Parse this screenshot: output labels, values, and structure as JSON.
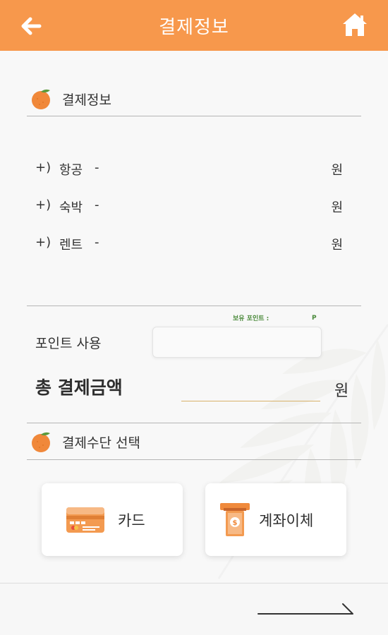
{
  "header": {
    "title": "결제정보",
    "back_icon": "arrow-left-icon",
    "home_icon": "home-icon",
    "background": "#f7984c"
  },
  "payment_info": {
    "heading": "결제정보",
    "icon": "tangerine-icon",
    "items": [
      {
        "prefix": "+)",
        "name": "항공",
        "dash": "-",
        "unit": "원"
      },
      {
        "prefix": "+)",
        "name": "숙박",
        "dash": "-",
        "unit": "원"
      },
      {
        "prefix": "+)",
        "name": "렌트",
        "dash": "-",
        "unit": "원"
      }
    ]
  },
  "points": {
    "caption": "보유 포인트 :",
    "unit": "P",
    "label": "포인트 사용",
    "input_value": ""
  },
  "total": {
    "label": "총 결제금액",
    "unit": "원"
  },
  "payment_method": {
    "heading": "결제수단 선택",
    "icon": "tangerine-icon",
    "options": [
      {
        "label": "카드",
        "icon": "credit-card-icon"
      },
      {
        "label": "계좌이체",
        "icon": "atm-cash-icon"
      }
    ]
  },
  "footer": {
    "next_icon": "arrow-right-icon"
  },
  "colors": {
    "accent": "#f7984c",
    "points_text": "#4b8a3b",
    "total_underline": "#d8b16a"
  }
}
